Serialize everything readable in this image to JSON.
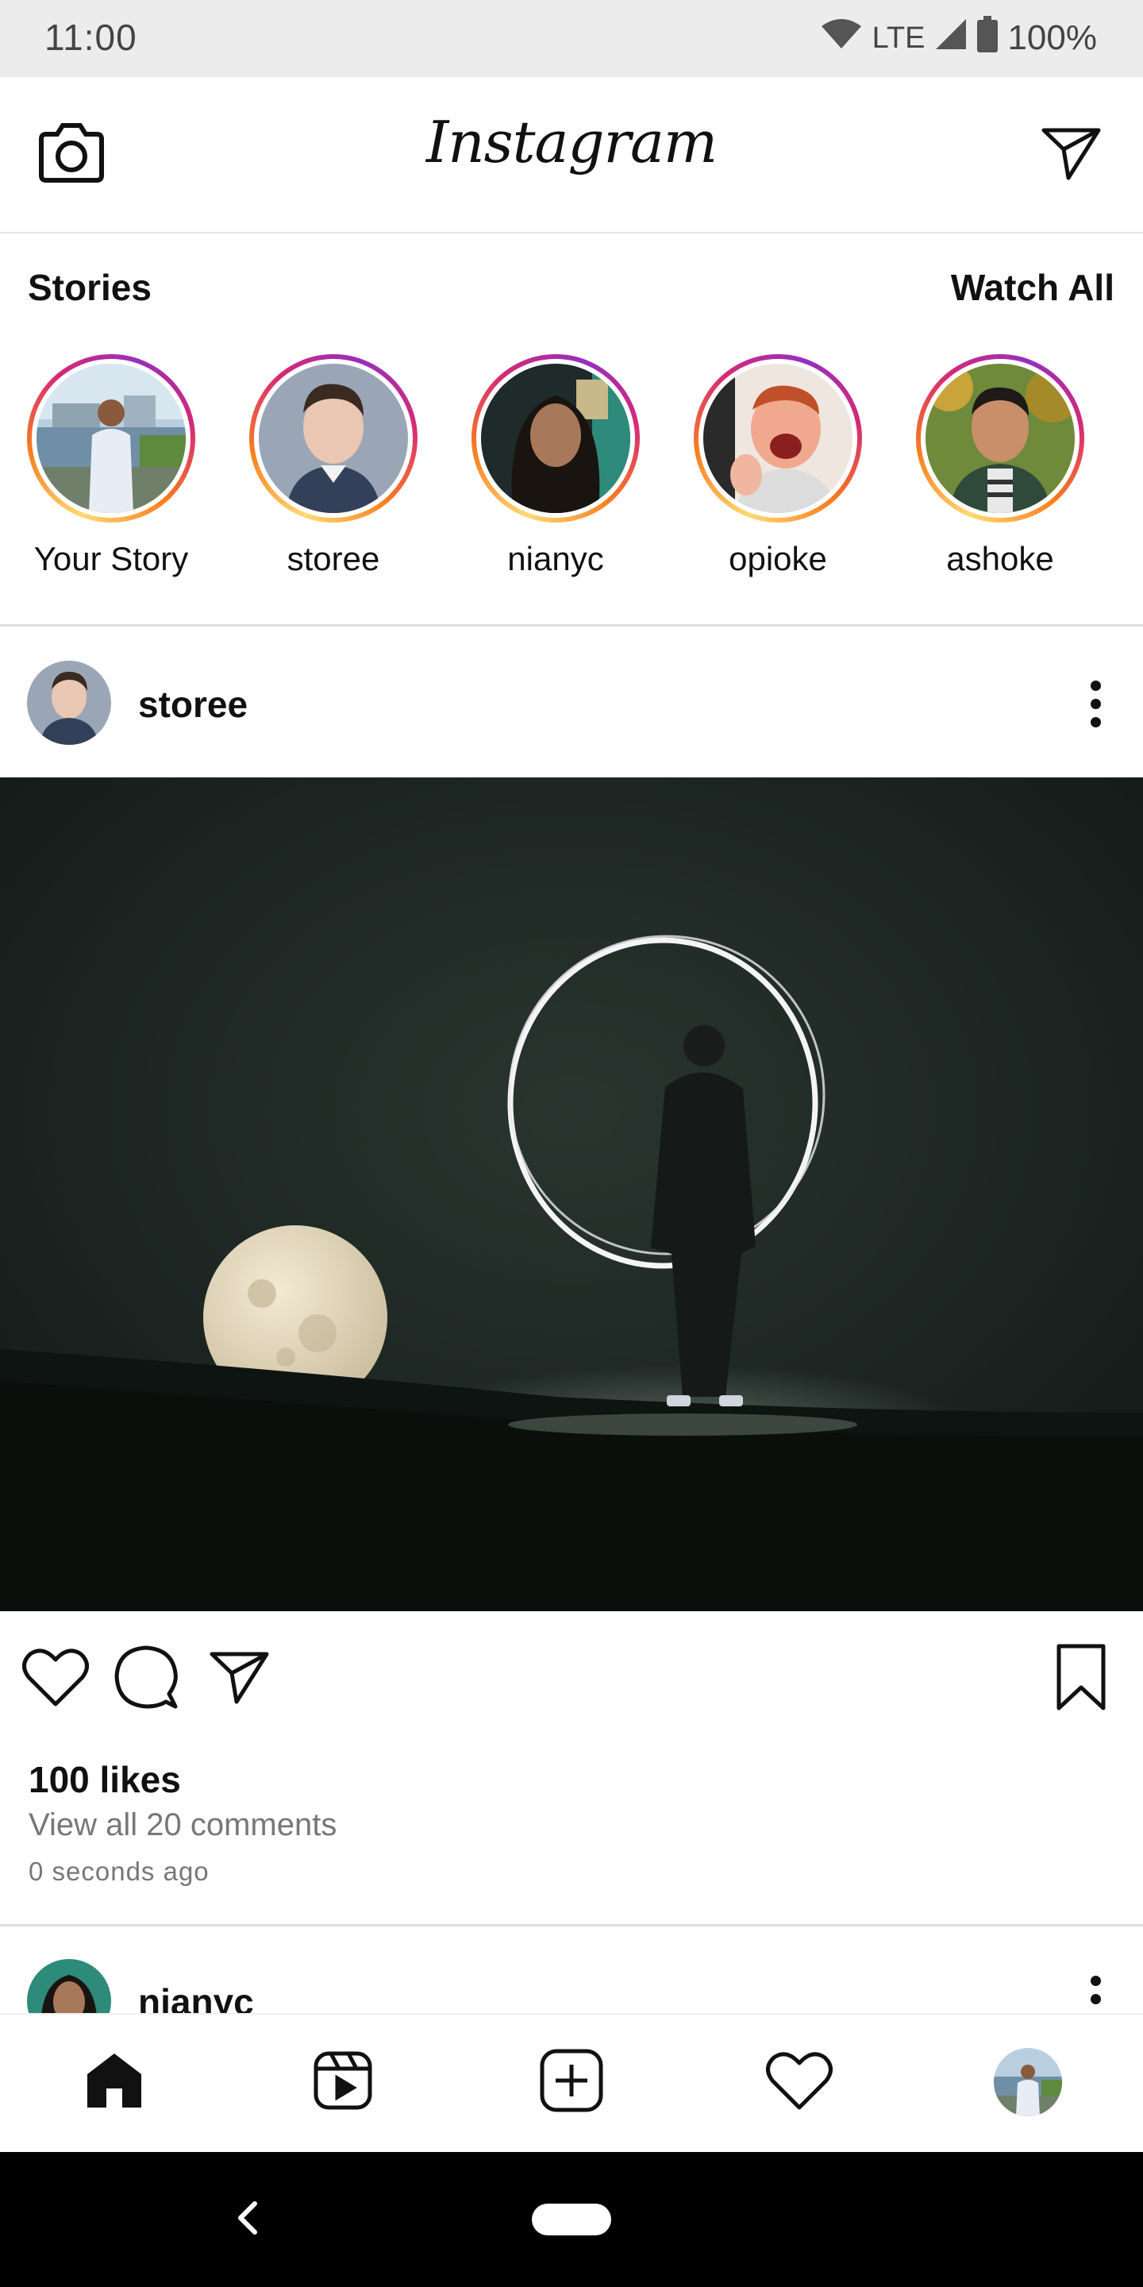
{
  "status_bar": {
    "time": "11:00",
    "network": "LTE",
    "battery": "100%"
  },
  "app_bar": {
    "logo": "Instagram",
    "camera_icon": "camera-icon",
    "dm_icon": "paper-plane-icon"
  },
  "stories": {
    "title": "Stories",
    "watch_all": "Watch All",
    "items": [
      {
        "label": "Your Story"
      },
      {
        "label": "storee"
      },
      {
        "label": "nianyc"
      },
      {
        "label": "opioke"
      },
      {
        "label": "ashoke"
      }
    ]
  },
  "post": {
    "username": "storee",
    "likes": "100 likes",
    "comments": "View all 20 comments",
    "time_ago": "0 seconds ago"
  },
  "next_post": {
    "username": "nianyc"
  },
  "bottom_nav": {
    "items": [
      "home-icon",
      "reels-icon",
      "create-icon",
      "heart-icon",
      "profile-avatar"
    ]
  },
  "colors": {
    "story_ring": "#d62976",
    "accent": "#111111",
    "secondary_text": "#777777"
  }
}
